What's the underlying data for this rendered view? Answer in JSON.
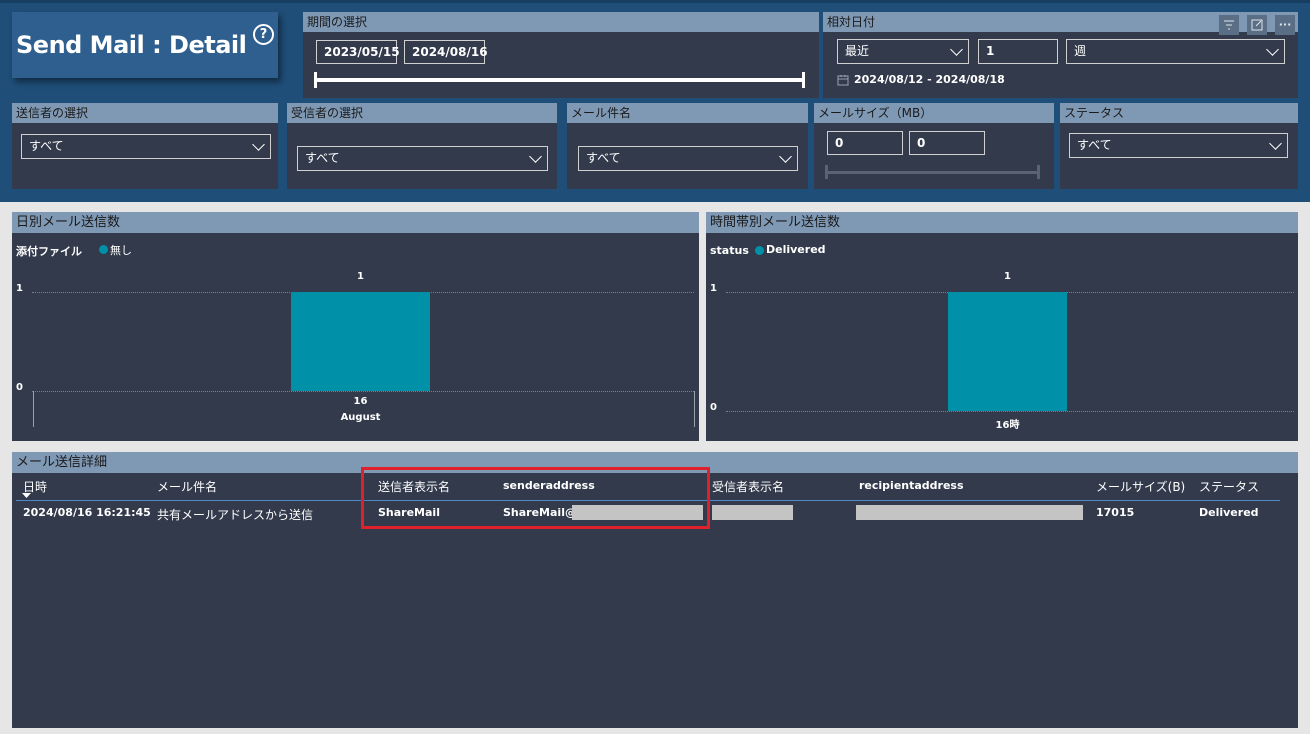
{
  "title": "Send Mail : Detail",
  "help_icon": "question-circle-icon",
  "period": {
    "header": "期間の選択",
    "start": "2023/05/15",
    "end": "2024/08/16"
  },
  "relative_date": {
    "header": "相対日付",
    "mode": "最近",
    "count": "1",
    "unit": "週",
    "range_text": "2024/08/12 - 2024/08/18",
    "calendar_icon": "calendar-icon"
  },
  "visual_header_icons": [
    "filter-icon",
    "focus-mode-icon",
    "more-options-icon"
  ],
  "filters": {
    "sender": {
      "header": "送信者の選択",
      "value": "すべて"
    },
    "recipient": {
      "header": "受信者の選択",
      "value": "すべて"
    },
    "subject": {
      "header": "メール件名",
      "value": "すべて"
    },
    "size": {
      "header": "メールサイズ（MB）",
      "min": "0",
      "max": "0"
    },
    "status": {
      "header": "ステータス",
      "value": "すべて"
    }
  },
  "daily_chart": {
    "header": "日別メール送信数",
    "legend_title": "添付ファイル",
    "legend_item": "無し",
    "color": "#0090a8",
    "chart_data": {
      "type": "bar",
      "categories": [
        "16"
      ],
      "x_group_label": "August",
      "values": [
        1
      ],
      "data_labels": [
        "1"
      ],
      "y_ticks": [
        "0",
        "1"
      ],
      "ylim": [
        0,
        1
      ]
    }
  },
  "hourly_chart": {
    "header": "時間帯別メール送信数",
    "legend_title": "status",
    "legend_item": "Delivered",
    "color": "#0090a8",
    "chart_data": {
      "type": "bar",
      "categories": [
        "16時"
      ],
      "values": [
        1
      ],
      "data_labels": [
        "1"
      ],
      "y_ticks": [
        "0",
        "1"
      ],
      "ylim": [
        0,
        1
      ]
    }
  },
  "detail_table": {
    "header": "メール送信詳細",
    "columns": [
      "日時",
      "メール件名",
      "送信者表示名",
      "senderaddress",
      "受信者表示名",
      "recipientaddress",
      "メールサイズ(B)",
      "ステータス"
    ],
    "rows": [
      {
        "datetime": "2024/08/16 16:21:45",
        "subject": "共有メールアドレスから送信",
        "sender_name": "ShareMail",
        "sender_address": "ShareMail@",
        "recipient_name": "",
        "recipient_address": "",
        "size": "17015",
        "status": "Delivered"
      }
    ]
  },
  "highlight_color": "#e0202a"
}
